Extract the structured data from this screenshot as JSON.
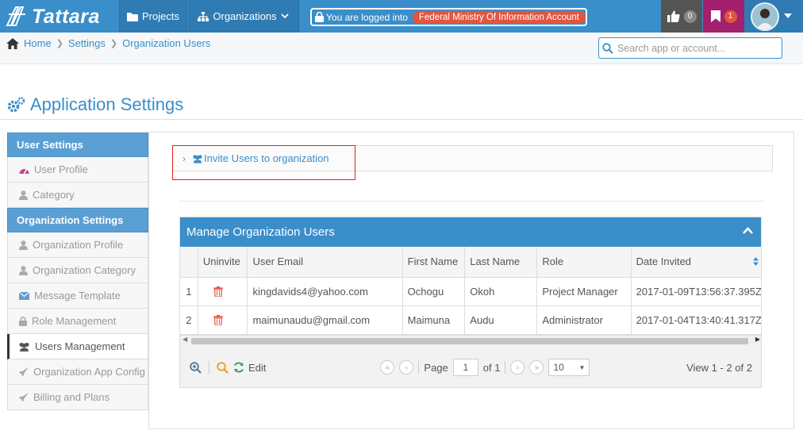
{
  "topbar": {
    "app_name": "Tattara",
    "nav_projects": "Projects",
    "nav_organizations": "Organizations",
    "login_prefix": "You are logged into",
    "account_name": "Federal Ministry Of Information Account",
    "likes_count": "0",
    "flags_count": "1",
    "colors": {
      "bar": "#3a8ec9",
      "likes_bg": "#555555",
      "flags_bg": "#a3206e",
      "account_badge": "#e4543f"
    }
  },
  "breadcrumb": {
    "home": "Home",
    "settings": "Settings",
    "current": "Organization Users"
  },
  "search": {
    "placeholder": "Search app or account..."
  },
  "page": {
    "title": "Application Settings"
  },
  "sidebar": {
    "user_settings": "User Settings",
    "user_items": [
      "User Profile",
      "Category"
    ],
    "org_settings": "Organization Settings",
    "org_items": [
      "Organization Profile",
      "Organization Category",
      "Message Template",
      "Role Management",
      "Users Management",
      "Organization App Config",
      "Billing and Plans"
    ],
    "active": "Users Management"
  },
  "invite": {
    "label": "Invite Users to organization"
  },
  "grid": {
    "title": "Manage Organization Users",
    "columns": [
      "Uninvite",
      "User Email",
      "First Name",
      "Last Name",
      "Role",
      "Date Invited"
    ],
    "rows": [
      {
        "num": "1",
        "email": "kingdavids4@yahoo.com",
        "first": "Ochogu",
        "last": "Okoh",
        "role": "Project Manager",
        "date": "2017-01-09T13:56:37.395Z"
      },
      {
        "num": "2",
        "email": "maimunaudu@gmail.com",
        "first": "Maimuna",
        "last": "Audu",
        "role": "Administrator",
        "date": "2017-01-04T13:40:41.317Z"
      }
    ],
    "edit_label": "Edit",
    "page_label": "Page",
    "page_value": "1",
    "of_label": "of 1",
    "page_size": "10",
    "view_info": "View 1 - 2 of 2"
  }
}
